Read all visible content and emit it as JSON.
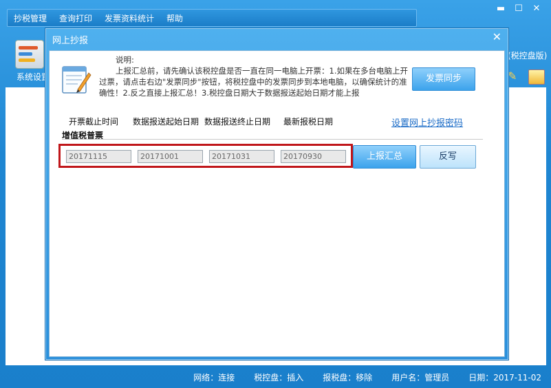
{
  "menubar": {
    "items": [
      "抄税管理",
      "查询打印",
      "发票资料统计",
      "帮助"
    ]
  },
  "window_controls": {
    "minimize": "▬",
    "maximize": "☐",
    "close": "✕"
  },
  "toolbar": {
    "sys_label": "系统设置",
    "brand_tail": "(税控盘版)"
  },
  "dialog": {
    "title": "网上抄报",
    "close": "✕",
    "note_heading": "说明:",
    "note_body": "上报汇总前，请先确认该税控盘是否一直在同一电脑上开票：1.如果在多台电脑上开过票，请点击右边\"发票同步\"按钮，将税控盘中的发票同步到本地电脑，以确保统计的准确性！2.反之直接上报汇总！3.税控盘日期大于数据报送起始日期才能上报",
    "sync_button": "发票同步",
    "columns": [
      "开票截止时间",
      "数据报送起始日期",
      "数据报送终止日期",
      "最新报税日期"
    ],
    "password_link": "设置网上抄报密码",
    "section_label": "增值税普票",
    "fields": {
      "invoice_deadline": "20171115",
      "report_start": "20171001",
      "report_end": "20171031",
      "latest_tax_date": "20170930"
    },
    "upload_button": "上报汇总",
    "rewrite_button": "反写"
  },
  "statusbar": {
    "network": "网络：连接",
    "tax_disk": "税控盘：插入",
    "tax_report_disk": "报税盘：移除",
    "user": "用户名：管理员",
    "date": "日期：2017-11-02"
  },
  "colors": {
    "accent": "#1f86d2",
    "highlight_border": "#c0161a",
    "link": "#1a6bc7"
  }
}
